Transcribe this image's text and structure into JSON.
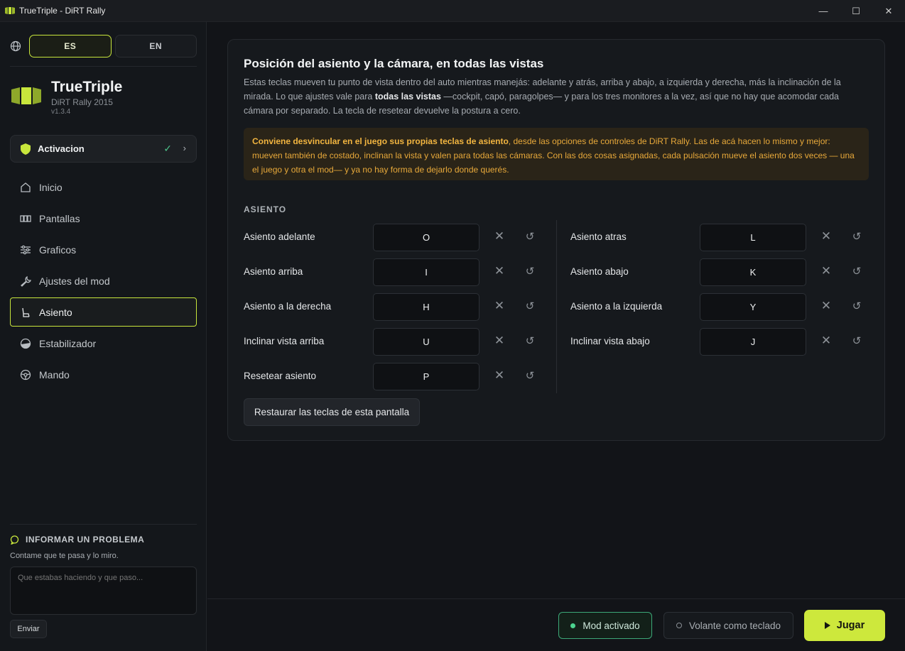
{
  "window": {
    "title": "TrueTriple - DiRT Rally",
    "minimize": "—",
    "maximize": "☐",
    "close": "✕"
  },
  "lang": {
    "es": "ES",
    "en": "EN",
    "active": "ES"
  },
  "brand": {
    "name": "TrueTriple",
    "game": "DiRT Rally 2015",
    "version": "v1.3.4"
  },
  "activation": {
    "label": "Activacion",
    "check": "✓",
    "chevron": "›"
  },
  "nav": [
    {
      "label": "Inicio",
      "icon": "home-icon"
    },
    {
      "label": "Pantallas",
      "icon": "monitors-icon"
    },
    {
      "label": "Graficos",
      "icon": "sliders-icon"
    },
    {
      "label": "Ajustes del mod",
      "icon": "wrench-icon"
    },
    {
      "label": "Asiento",
      "icon": "seat-icon",
      "active": true
    },
    {
      "label": "Estabilizador",
      "icon": "horizon-icon"
    },
    {
      "label": "Mando",
      "icon": "gamepad-icon"
    }
  ],
  "report": {
    "title": "INFORMAR UN PROBLEMA",
    "subtitle": "Contame que te pasa y lo miro.",
    "placeholder": "Que estabas haciendo y que paso...",
    "send": "Enviar"
  },
  "card": {
    "title": "Posición del asiento y la cámara, en todas las vistas",
    "desc_1": "Estas teclas mueven tu punto de vista dentro del auto mientras manejás: adelante y atrás, arriba y abajo, a izquierda y derecha, más la inclinación de la mirada. Lo que ajustes vale para ",
    "desc_bold": "todas las vistas",
    "desc_2": " —cockpit, capó, paragolpes— y para los tres monitores a la vez, así que no hay que acomodar cada cámara por separado. La tecla de resetear devuelve la postura a cero.",
    "warn_bold": "Conviene desvincular en el juego sus propias teclas de asiento",
    "warn_rest": ", desde las opciones de controles de DiRT Rally. Las de acá hacen lo mismo y mejor: mueven también de costado, inclinan la vista y valen para todas las cámaras. Con las dos cosas asignadas, cada pulsación mueve el asiento dos veces — una el juego y otra el mod— y ya no hay forma de dejarlo donde querés.",
    "section": "ASIENTO",
    "restore": "Restaurar las teclas de esta pantalla"
  },
  "bindings_left": [
    {
      "label": "Asiento adelante",
      "key": "O"
    },
    {
      "label": "Asiento arriba",
      "key": "I"
    },
    {
      "label": "Asiento a la derecha",
      "key": "H"
    },
    {
      "label": "Inclinar vista arriba",
      "key": "U"
    },
    {
      "label": "Resetear asiento",
      "key": "P"
    }
  ],
  "bindings_right": [
    {
      "label": "Asiento atras",
      "key": "L"
    },
    {
      "label": "Asiento abajo",
      "key": "K"
    },
    {
      "label": "Asiento a la izquierda",
      "key": "Y"
    },
    {
      "label": "Inclinar vista abajo",
      "key": "J"
    }
  ],
  "glyphs": {
    "clear": "✕",
    "reset": "↺"
  },
  "footer": {
    "mod": "Mod activado",
    "wheel": "Volante como teclado",
    "play": "Jugar"
  },
  "colors": {
    "accent": "#c8e63c",
    "ok": "#4cc38a",
    "warn": "#e8a93a"
  }
}
